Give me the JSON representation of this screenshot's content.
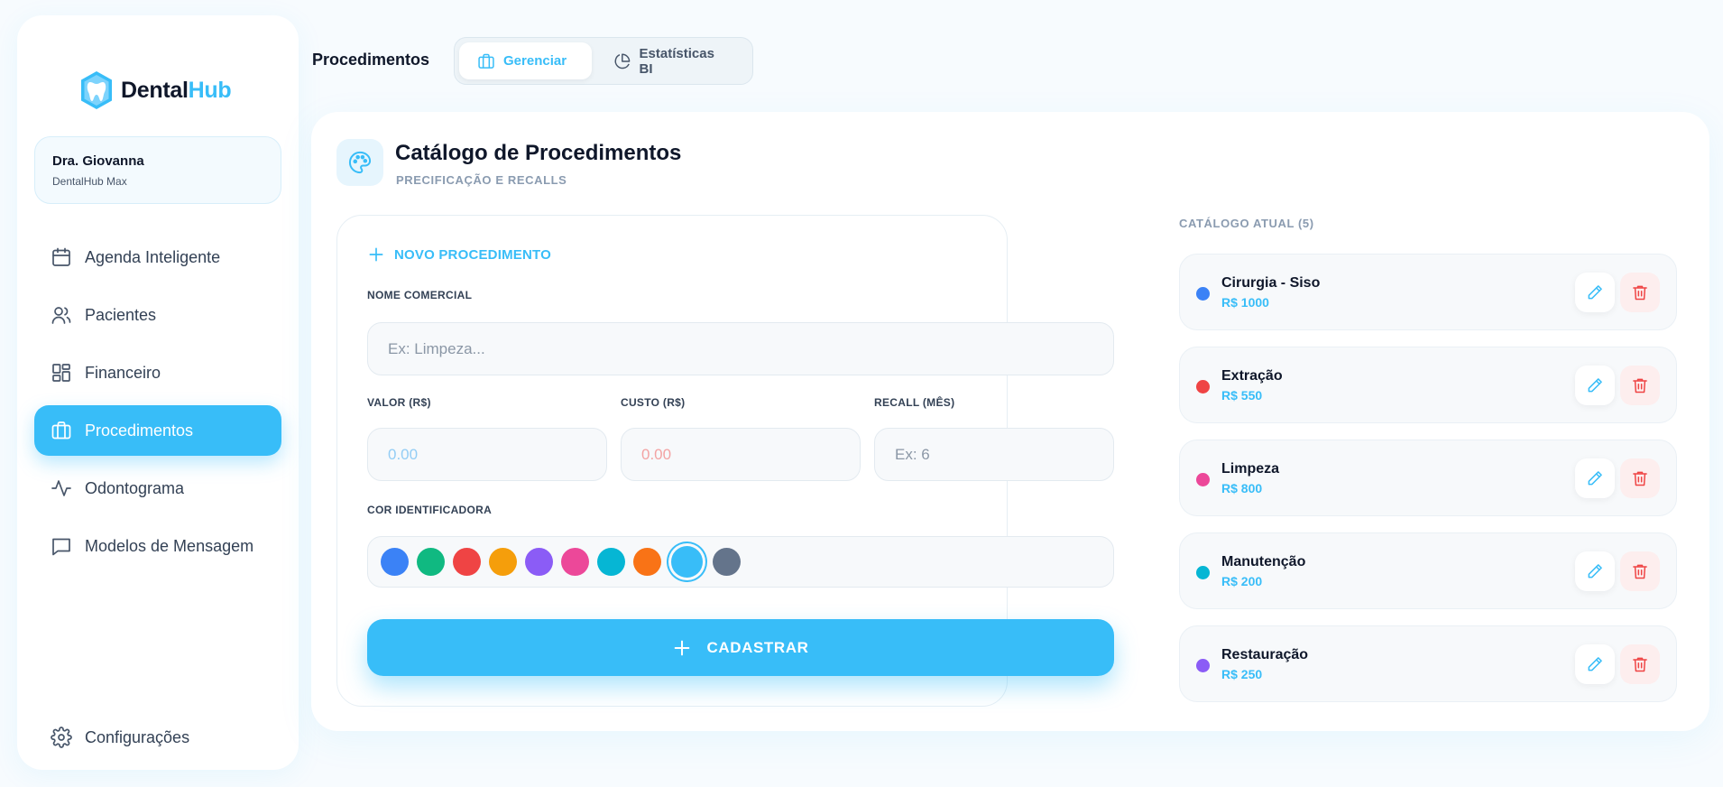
{
  "app": {
    "logo": {
      "part1": "Dental",
      "part2": "Hub"
    }
  },
  "profile": {
    "name": "Dra. Giovanna",
    "plan": "DentalHub Max"
  },
  "sidebar": {
    "items": [
      {
        "label": "Agenda Inteligente",
        "icon": "calendar-icon"
      },
      {
        "label": "Pacientes",
        "icon": "users-icon"
      },
      {
        "label": "Financeiro",
        "icon": "dashboard-icon"
      },
      {
        "label": "Procedimentos",
        "icon": "briefcase-icon",
        "active": true
      },
      {
        "label": "Odontograma",
        "icon": "activity-icon"
      },
      {
        "label": "Modelos de Mensagem",
        "icon": "message-icon"
      }
    ],
    "settings": {
      "label": "Configurações",
      "icon": "gear-icon"
    }
  },
  "header": {
    "title": "Procedimentos",
    "tabs": [
      {
        "label": "Gerenciar",
        "icon": "briefcase-icon",
        "active": true
      },
      {
        "label": "Estatísticas BI",
        "icon": "pie-chart-icon"
      }
    ]
  },
  "card": {
    "title": "Catálogo de Procedimentos",
    "subtitle": "PRECIFICAÇÃO E RECALLS",
    "icon": "palette-icon"
  },
  "form": {
    "heading": "NOVO PROCEDIMENTO",
    "name_label": "NOME COMERCIAL",
    "name_placeholder": "Ex: Limpeza...",
    "price_label": "VALOR (R$)",
    "price_placeholder": "0.00",
    "cost_label": "CUSTO (R$)",
    "cost_placeholder": "0.00",
    "recall_label": "RECALL (MÊS)",
    "recall_placeholder": "Ex: 6",
    "color_label": "COR IDENTIFICADORA",
    "colors": [
      "#3b82f6",
      "#10b981",
      "#ef4444",
      "#f59e0b",
      "#8b5cf6",
      "#ec4899",
      "#06b6d4",
      "#f97316",
      "#38bdf8",
      "#64748b"
    ],
    "selected_color": "#38bdf8",
    "submit_label": "CADASTRAR"
  },
  "catalog": {
    "label": "CATÁLOGO ATUAL (5)",
    "items": [
      {
        "name": "Cirurgia - Siso",
        "price": "R$ 1000",
        "color": "#3b82f6"
      },
      {
        "name": "Extração",
        "price": "R$ 550",
        "color": "#ef4444"
      },
      {
        "name": "Limpeza",
        "price": "R$ 800",
        "color": "#ec4899"
      },
      {
        "name": "Manutenção",
        "price": "R$ 200",
        "color": "#06b6d4"
      },
      {
        "name": "Restauração",
        "price": "R$ 250",
        "color": "#8b5cf6"
      }
    ]
  }
}
